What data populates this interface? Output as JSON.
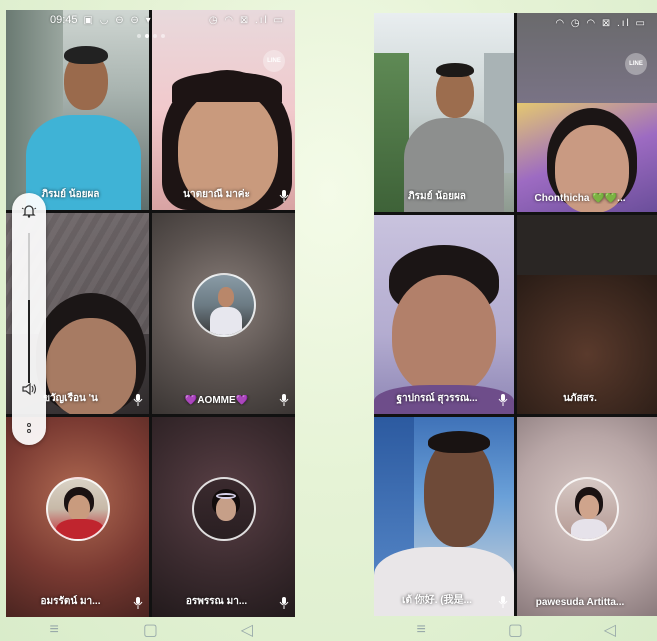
{
  "left_phone": {
    "status": {
      "time": "09:45",
      "left_icons": "▣ ◡ ⊖ ⊖ ▾",
      "right_icons": "◷ ◠ ⊠ .ıl ▭"
    },
    "line_logo": "LINE",
    "participants": [
      {
        "name": "ภิรมย์ น้อยผล",
        "mic": false
      },
      {
        "name": "นาตยาณี มาค่ะ",
        "mic": true
      },
      {
        "name": "ขวัญเรือน 'น",
        "mic": true
      },
      {
        "name": "💜AOMME💜",
        "mic": true
      },
      {
        "name": "อมรรัตน์ มา...",
        "mic": true
      },
      {
        "name": "อรพรรณ มา...",
        "mic": true
      }
    ],
    "volume_level": 0.55
  },
  "right_phone": {
    "status": {
      "time": "",
      "right_icons": "◠ ◷ ◠ ⊠ .ıl ▭"
    },
    "line_logo": "LINE",
    "participants": [
      {
        "name": "ภิรมย์ น้อยผล",
        "mic": false
      },
      {
        "name": "Chonthicha 💚💚...",
        "mic": false
      },
      {
        "name": "ฐาปกรณ์ สุวรรณ...",
        "mic": true
      },
      {
        "name": "นภัสสร.",
        "mic": false
      },
      {
        "name": "เต้ 你好. (我是...",
        "mic": true
      },
      {
        "name": "pawesuda Artitta...",
        "mic": false
      }
    ]
  },
  "navbar": {
    "menu": "≡",
    "home": "▢",
    "back": "◁"
  }
}
